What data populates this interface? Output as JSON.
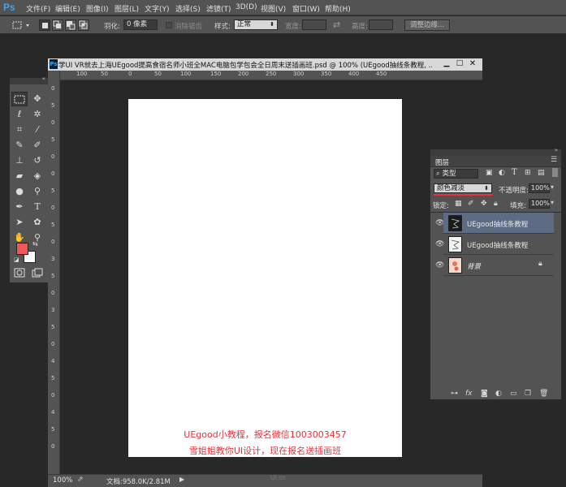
{
  "app": {
    "logo": "Ps"
  },
  "menu": [
    "文件(F)",
    "编辑(E)",
    "图像(I)",
    "图层(L)",
    "文字(Y)",
    "选择(S)",
    "滤镜(T)",
    "3D(D)",
    "视图(V)",
    "窗口(W)",
    "帮助(H)"
  ],
  "options": {
    "feather_label": "羽化:",
    "feather_value": "0 像素",
    "antialias_label": "消除锯齿",
    "style_label": "样式:",
    "style_value": "正常",
    "width_label": "宽度:",
    "height_label": "高度:",
    "refine_button": "调整边缘..."
  },
  "document": {
    "title": "学UI VR就去上海UEgood提高食宿名师小班全MAC电脑包学包会全日周末送插画班.psd @ 100% (UEgood抽线条教程, ...",
    "zoom": "100%",
    "doc_size": "文档:958.0K/2.81M",
    "hruler": [
      "100",
      "50",
      "0",
      "50",
      "100",
      "150",
      "200",
      "250",
      "300",
      "350",
      "400",
      "450"
    ],
    "vruler": [
      "0",
      "5",
      "0",
      "5",
      "0",
      "0",
      "5",
      "0",
      "5",
      "0",
      "3",
      "5",
      "0",
      "3",
      "5",
      "0",
      "4",
      "5",
      "0",
      "4",
      "5",
      "0"
    ]
  },
  "canvas_text": {
    "line1": "UEgood小教程，报名微信1003003457",
    "line2": "雪姐姐教你UI设计，现在报名送插画班"
  },
  "layers_panel": {
    "title": "图层",
    "filter_kind": "类型",
    "blend_mode": "颜色减淡",
    "opacity_label": "不透明度:",
    "opacity_value": "100%",
    "lock_label": "锁定:",
    "fill_label": "填充:",
    "fill_value": "100%",
    "layers": [
      {
        "name": "UEgood抽线条教程",
        "selected": true,
        "italic": false
      },
      {
        "name": "UEgood抽线条教程",
        "selected": false,
        "italic": false
      },
      {
        "name": "背景",
        "selected": false,
        "italic": true
      }
    ]
  },
  "watermark": "UI.cn",
  "colors": {
    "foreground": "#f25757",
    "background": "#ffffff",
    "accent": "#31a8ff",
    "selected_layer": "#5d6b85"
  }
}
